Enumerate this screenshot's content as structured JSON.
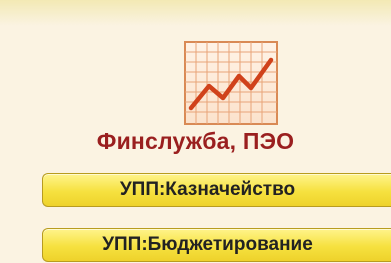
{
  "section": {
    "title": "Финслужба, ПЭО",
    "icon": "line-chart-icon"
  },
  "buttons": [
    {
      "label": "УПП:Казначейство"
    },
    {
      "label": "УПП:Бюджетирование"
    }
  ],
  "colors": {
    "background": "#fbf3e2",
    "title": "#9a1f1f",
    "button_fill": "#f6e13f",
    "button_border": "#b89c1f",
    "chart_line": "#d0421b",
    "chart_grid": "#e39a6a"
  }
}
